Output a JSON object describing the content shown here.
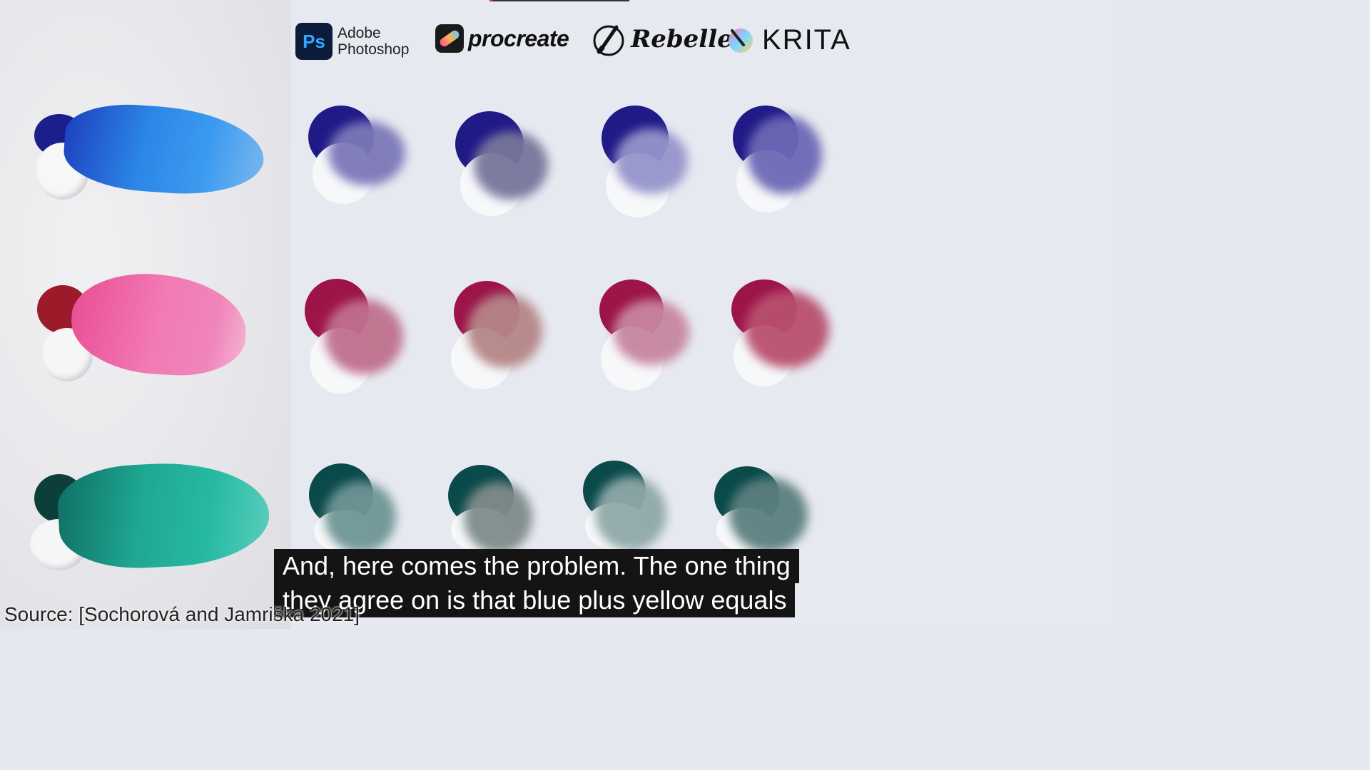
{
  "video": {
    "progress_fraction": 0.02,
    "progress_color": "#e0266a"
  },
  "logos": {
    "photoshop_badge": "Ps",
    "photoshop_line1": "Adobe",
    "photoshop_line2": "Photoshop",
    "procreate": "procreate",
    "rebelle": "Rebelle",
    "krita": "KRITA"
  },
  "paint_rows": [
    {
      "name": "blue",
      "dark": "#1f1a86",
      "mix_ps": "#7b78b8",
      "mix_procreate": "#77769c",
      "mix_rebelle": "#9694cc",
      "mix_krita": "#6c68b6",
      "paint": "#2f7fe0"
    },
    {
      "name": "magenta",
      "dark": "#9c1448",
      "mix_ps": "#c0708e",
      "mix_procreate": "#b58688",
      "mix_rebelle": "#c786a0",
      "mix_krita": "#b8506f",
      "paint": "#ee6aa8"
    },
    {
      "name": "teal",
      "dark": "#0b4a4a",
      "mix_ps": "#6f9595",
      "mix_procreate": "#7f8b8b",
      "mix_rebelle": "#8fa8a8",
      "mix_krita": "#5c7f7f",
      "paint": "#23b39c"
    }
  ],
  "subtitle": {
    "line1": "And, here comes the problem. The one thing",
    "line2": "they agree on is that blue plus yellow equals"
  },
  "source_caption": "Source: [Sochorová and Jamriška 2021]"
}
